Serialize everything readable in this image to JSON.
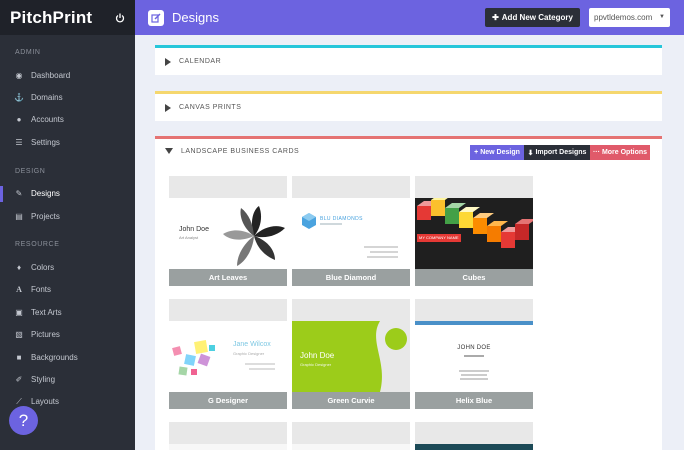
{
  "brand": "PitchPrint",
  "sidebar": {
    "sections": [
      {
        "title": "ADMIN",
        "items": [
          {
            "label": "Dashboard",
            "icon": "dashboard-icon"
          },
          {
            "label": "Domains",
            "icon": "anchor-icon"
          },
          {
            "label": "Accounts",
            "icon": "user-icon"
          },
          {
            "label": "Settings",
            "icon": "sliders-icon"
          }
        ]
      },
      {
        "title": "DESIGN",
        "items": [
          {
            "label": "Designs",
            "icon": "edit-icon",
            "active": true
          },
          {
            "label": "Projects",
            "icon": "projects-icon"
          }
        ]
      },
      {
        "title": "RESOURCE",
        "items": [
          {
            "label": "Colors",
            "icon": "paint-icon"
          },
          {
            "label": "Fonts",
            "icon": "font-icon"
          },
          {
            "label": "Text Arts",
            "icon": "text-art-icon"
          },
          {
            "label": "Pictures",
            "icon": "picture-icon"
          },
          {
            "label": "Backgrounds",
            "icon": "background-icon"
          },
          {
            "label": "Styling",
            "icon": "brush-icon"
          },
          {
            "label": "Layouts",
            "icon": "layout-icon"
          }
        ]
      }
    ],
    "help": "?"
  },
  "header": {
    "title": "Designs",
    "add_category": "Add New Category",
    "domain": "ppvtldemos.com"
  },
  "categories": [
    {
      "name": "CALENDAR",
      "accent": "#26c6da",
      "expanded": false
    },
    {
      "name": "CANVAS PRINTS",
      "accent": "#f5d76e",
      "expanded": false
    },
    {
      "name": "LANDSCAPE BUSINESS CARDS",
      "accent": "#e57373",
      "expanded": true
    }
  ],
  "actions": {
    "new_design": "New Design",
    "import_designs": "Import Designs",
    "more_options": "More Options"
  },
  "designs": [
    {
      "name": "Art Leaves"
    },
    {
      "name": "Blue Diamond"
    },
    {
      "name": "Cubes"
    },
    {
      "name": "G Designer"
    },
    {
      "name": "Green Curvie"
    },
    {
      "name": "Helix Blue"
    }
  ],
  "card_text": {
    "art_leaves": {
      "name": "John Doe",
      "title": "Art Analyst"
    },
    "blue_diamond": {
      "company": "BLU DIAMONDS"
    },
    "cubes": {
      "company": "MY COMPANY NAME"
    },
    "g_designer": {
      "name": "Jane Wilcox",
      "title": "Graphic Designer"
    },
    "green_curvie": {
      "name": "John Doe",
      "title": "Graphic Designer"
    },
    "helix_blue": {
      "name": "JOHN DOE"
    }
  },
  "colors": {
    "accent": "#6c63e0",
    "sidebar": "#2b2f38",
    "new_design_btn": "#6c63e0",
    "import_btn": "#2b2f38",
    "more_btn": "#e05a6a"
  }
}
